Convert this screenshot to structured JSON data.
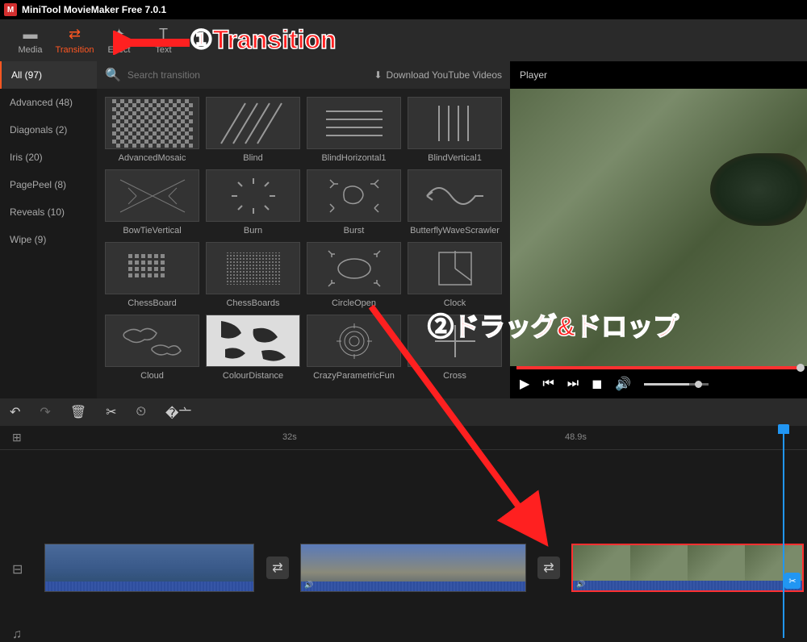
{
  "app": {
    "title": "MiniTool MovieMaker Free 7.0.1"
  },
  "toolbar": {
    "media": "Media",
    "transition": "Transition",
    "effect": "Effect",
    "text": "Text"
  },
  "sidebar": {
    "items": [
      {
        "label": "All (97)"
      },
      {
        "label": "Advanced (48)"
      },
      {
        "label": "Diagonals (2)"
      },
      {
        "label": "Iris (20)"
      },
      {
        "label": "PagePeel (8)"
      },
      {
        "label": "Reveals (10)"
      },
      {
        "label": "Wipe (9)"
      }
    ]
  },
  "search": {
    "placeholder": "Search transition"
  },
  "download_link": "Download YouTube Videos",
  "transitions": [
    {
      "label": "AdvancedMosaic"
    },
    {
      "label": "Blind"
    },
    {
      "label": "BlindHorizontal1"
    },
    {
      "label": "BlindVertical1"
    },
    {
      "label": "BowTieVertical"
    },
    {
      "label": "Burn"
    },
    {
      "label": "Burst"
    },
    {
      "label": "ButterflyWaveScrawler"
    },
    {
      "label": "ChessBoard"
    },
    {
      "label": "ChessBoards"
    },
    {
      "label": "CircleOpen"
    },
    {
      "label": "Clock"
    },
    {
      "label": "Cloud"
    },
    {
      "label": "ColourDistance"
    },
    {
      "label": "CrazyParametricFun"
    },
    {
      "label": "Cross"
    }
  ],
  "player": {
    "title": "Player"
  },
  "timeline": {
    "markers": {
      "t1": "32s",
      "t2": "48.9s"
    }
  },
  "annotations": {
    "label1": "①Transition",
    "label2": "②ドラッグ&ドロップ"
  }
}
